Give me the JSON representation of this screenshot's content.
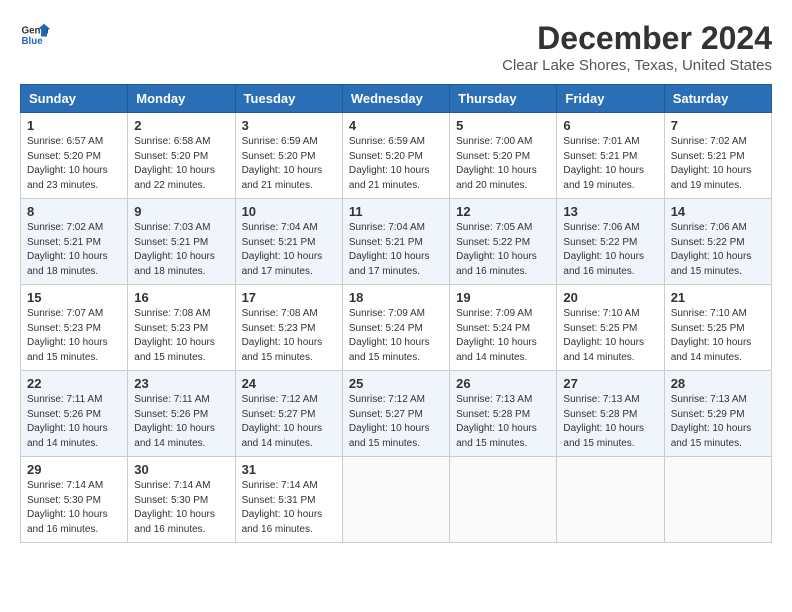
{
  "header": {
    "logo_line1": "General",
    "logo_line2": "Blue",
    "month": "December 2024",
    "location": "Clear Lake Shores, Texas, United States"
  },
  "weekdays": [
    "Sunday",
    "Monday",
    "Tuesday",
    "Wednesday",
    "Thursday",
    "Friday",
    "Saturday"
  ],
  "weeks": [
    [
      {
        "day": "1",
        "info": "Sunrise: 6:57 AM\nSunset: 5:20 PM\nDaylight: 10 hours\nand 23 minutes."
      },
      {
        "day": "2",
        "info": "Sunrise: 6:58 AM\nSunset: 5:20 PM\nDaylight: 10 hours\nand 22 minutes."
      },
      {
        "day": "3",
        "info": "Sunrise: 6:59 AM\nSunset: 5:20 PM\nDaylight: 10 hours\nand 21 minutes."
      },
      {
        "day": "4",
        "info": "Sunrise: 6:59 AM\nSunset: 5:20 PM\nDaylight: 10 hours\nand 21 minutes."
      },
      {
        "day": "5",
        "info": "Sunrise: 7:00 AM\nSunset: 5:20 PM\nDaylight: 10 hours\nand 20 minutes."
      },
      {
        "day": "6",
        "info": "Sunrise: 7:01 AM\nSunset: 5:21 PM\nDaylight: 10 hours\nand 19 minutes."
      },
      {
        "day": "7",
        "info": "Sunrise: 7:02 AM\nSunset: 5:21 PM\nDaylight: 10 hours\nand 19 minutes."
      }
    ],
    [
      {
        "day": "8",
        "info": "Sunrise: 7:02 AM\nSunset: 5:21 PM\nDaylight: 10 hours\nand 18 minutes."
      },
      {
        "day": "9",
        "info": "Sunrise: 7:03 AM\nSunset: 5:21 PM\nDaylight: 10 hours\nand 18 minutes."
      },
      {
        "day": "10",
        "info": "Sunrise: 7:04 AM\nSunset: 5:21 PM\nDaylight: 10 hours\nand 17 minutes."
      },
      {
        "day": "11",
        "info": "Sunrise: 7:04 AM\nSunset: 5:21 PM\nDaylight: 10 hours\nand 17 minutes."
      },
      {
        "day": "12",
        "info": "Sunrise: 7:05 AM\nSunset: 5:22 PM\nDaylight: 10 hours\nand 16 minutes."
      },
      {
        "day": "13",
        "info": "Sunrise: 7:06 AM\nSunset: 5:22 PM\nDaylight: 10 hours\nand 16 minutes."
      },
      {
        "day": "14",
        "info": "Sunrise: 7:06 AM\nSunset: 5:22 PM\nDaylight: 10 hours\nand 15 minutes."
      }
    ],
    [
      {
        "day": "15",
        "info": "Sunrise: 7:07 AM\nSunset: 5:23 PM\nDaylight: 10 hours\nand 15 minutes."
      },
      {
        "day": "16",
        "info": "Sunrise: 7:08 AM\nSunset: 5:23 PM\nDaylight: 10 hours\nand 15 minutes."
      },
      {
        "day": "17",
        "info": "Sunrise: 7:08 AM\nSunset: 5:23 PM\nDaylight: 10 hours\nand 15 minutes."
      },
      {
        "day": "18",
        "info": "Sunrise: 7:09 AM\nSunset: 5:24 PM\nDaylight: 10 hours\nand 15 minutes."
      },
      {
        "day": "19",
        "info": "Sunrise: 7:09 AM\nSunset: 5:24 PM\nDaylight: 10 hours\nand 14 minutes."
      },
      {
        "day": "20",
        "info": "Sunrise: 7:10 AM\nSunset: 5:25 PM\nDaylight: 10 hours\nand 14 minutes."
      },
      {
        "day": "21",
        "info": "Sunrise: 7:10 AM\nSunset: 5:25 PM\nDaylight: 10 hours\nand 14 minutes."
      }
    ],
    [
      {
        "day": "22",
        "info": "Sunrise: 7:11 AM\nSunset: 5:26 PM\nDaylight: 10 hours\nand 14 minutes."
      },
      {
        "day": "23",
        "info": "Sunrise: 7:11 AM\nSunset: 5:26 PM\nDaylight: 10 hours\nand 14 minutes."
      },
      {
        "day": "24",
        "info": "Sunrise: 7:12 AM\nSunset: 5:27 PM\nDaylight: 10 hours\nand 14 minutes."
      },
      {
        "day": "25",
        "info": "Sunrise: 7:12 AM\nSunset: 5:27 PM\nDaylight: 10 hours\nand 15 minutes."
      },
      {
        "day": "26",
        "info": "Sunrise: 7:13 AM\nSunset: 5:28 PM\nDaylight: 10 hours\nand 15 minutes."
      },
      {
        "day": "27",
        "info": "Sunrise: 7:13 AM\nSunset: 5:28 PM\nDaylight: 10 hours\nand 15 minutes."
      },
      {
        "day": "28",
        "info": "Sunrise: 7:13 AM\nSunset: 5:29 PM\nDaylight: 10 hours\nand 15 minutes."
      }
    ],
    [
      {
        "day": "29",
        "info": "Sunrise: 7:14 AM\nSunset: 5:30 PM\nDaylight: 10 hours\nand 16 minutes."
      },
      {
        "day": "30",
        "info": "Sunrise: 7:14 AM\nSunset: 5:30 PM\nDaylight: 10 hours\nand 16 minutes."
      },
      {
        "day": "31",
        "info": "Sunrise: 7:14 AM\nSunset: 5:31 PM\nDaylight: 10 hours\nand 16 minutes."
      },
      {
        "day": "",
        "info": ""
      },
      {
        "day": "",
        "info": ""
      },
      {
        "day": "",
        "info": ""
      },
      {
        "day": "",
        "info": ""
      }
    ]
  ]
}
